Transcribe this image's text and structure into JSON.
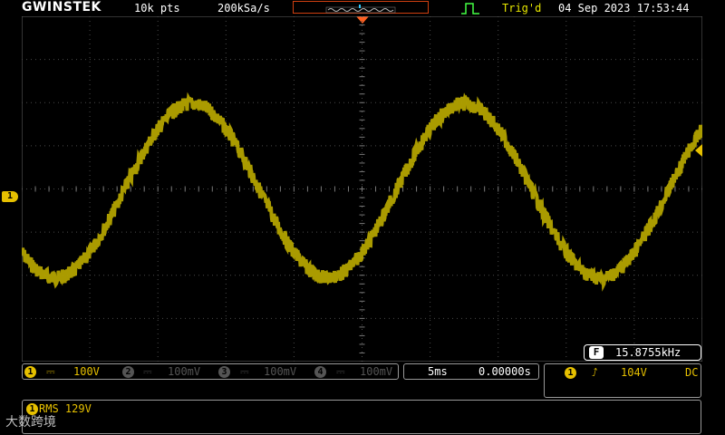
{
  "header": {
    "logo": "GWINSTEK",
    "record_length": "10k pts",
    "sample_rate": "200kSa/s",
    "trigger_status": "Trig'd",
    "datetime": "04 Sep 2023 17:53:44"
  },
  "waveform": {
    "color": "#b3a300",
    "cycles_visible": 2.5
  },
  "ch1_label": "1",
  "frequency": {
    "icon": "F",
    "value": "15.8755kHz"
  },
  "channels": [
    {
      "num": "1",
      "coupling_symbol": "⎓",
      "scale": "100V",
      "active": true
    },
    {
      "num": "2",
      "coupling_symbol": "⎓",
      "scale": "100mV",
      "active": false
    },
    {
      "num": "3",
      "coupling_symbol": "⎓",
      "scale": "100mV",
      "active": false
    },
    {
      "num": "4",
      "coupling_symbol": "⎓",
      "scale": "100mV",
      "active": false
    }
  ],
  "timebase": {
    "scale": "5ms",
    "position": "0.00000s"
  },
  "trigger": {
    "source": "1",
    "slope_symbol": "⭜",
    "level": "104V",
    "coupling": "DC"
  },
  "measurement": {
    "channel": "1",
    "text": "RMS 129V"
  },
  "watermark": "大数跨境"
}
